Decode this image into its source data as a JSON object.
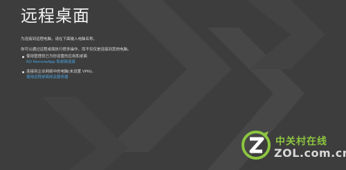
{
  "page": {
    "title": "远程桌面",
    "intro": "为连接到远程电脑，请在下面输入电脑名称。",
    "description": "你可以通过远程桌面执行很多操作，而不仅仅是连接到其他电脑。",
    "bullets": [
      {
        "text": "使用管理员已为你设置的应用和桌面",
        "link": "RD RemoteApp 和桌面连接"
      },
      {
        "text": "连接到企业网络中的电脑(未设置 VPN)。",
        "link": "使用远程桌面网关服务器"
      }
    ]
  },
  "watermark": {
    "name": "中关村在线",
    "domain": "ZOL.com.cn"
  },
  "colors": {
    "background": "#3d3d3d",
    "chevron": "#474747",
    "link": "#4aa3df",
    "watermark_green": "#8cc63f"
  }
}
